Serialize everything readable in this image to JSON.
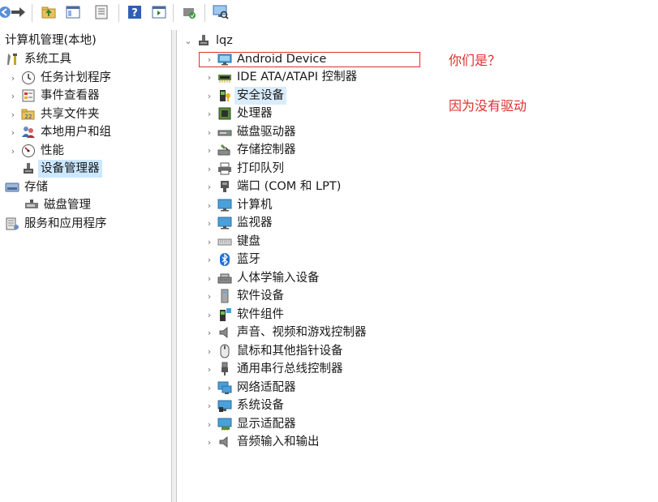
{
  "toolbar": {
    "buttons": [
      {
        "name": "back-icon"
      },
      {
        "name": "forward-icon"
      },
      {
        "name": "up-folder-icon"
      },
      {
        "name": "show-hide-tree-icon"
      },
      {
        "name": "properties-icon"
      },
      {
        "name": "help-icon"
      },
      {
        "name": "show-action-pane-icon"
      },
      {
        "name": "update-driver-icon"
      },
      {
        "name": "scan-hardware-icon"
      }
    ]
  },
  "left_tree": {
    "root": "计算机管理(本地)",
    "system_tools": "系统工具",
    "task_scheduler": "任务计划程序",
    "event_viewer": "事件查看器",
    "shared_folders": "共享文件夹",
    "local_users": "本地用户和组",
    "performance": "性能",
    "device_manager": "设备管理器",
    "storage": "存储",
    "disk_management": "磁盘管理",
    "services_apps": "服务和应用程序"
  },
  "device_tree": {
    "computer": "lqz",
    "categories": {
      "android": "Android Device",
      "ide": "IDE ATA/ATAPI 控制器",
      "security": "安全设备",
      "processor": "处理器",
      "disk_drives": "磁盘驱动器",
      "storage_ctrl": "存储控制器",
      "print_queue": "打印队列",
      "ports": "端口 (COM 和 LPT)",
      "computer": "计算机",
      "monitors": "监视器",
      "keyboards": "键盘",
      "bluetooth": "蓝牙",
      "hid": "人体学输入设备",
      "software_devices": "软件设备",
      "software_components": "软件组件",
      "sound": "声音、视频和游戏控制器",
      "mice": "鼠标和其他指针设备",
      "usb": "通用串行总线控制器",
      "network": "网络适配器",
      "system_devices": "系统设备",
      "display": "显示适配器",
      "audio_io": "音频输入和输出"
    }
  },
  "annotations": {
    "question": "你们是？",
    "answer": "因为没有驱动"
  },
  "colors": {
    "annotation_red": "#e0302a",
    "selection": "#cce8ff"
  }
}
